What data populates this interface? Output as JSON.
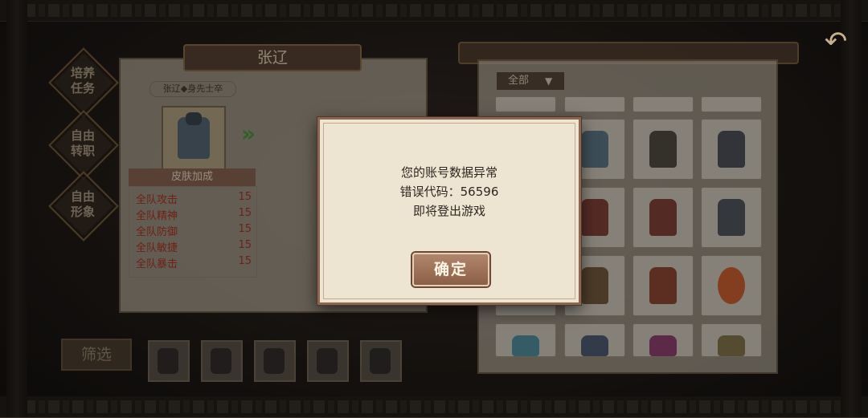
{
  "hero": {
    "name": "张辽",
    "subtitle": "张辽◆身先士卒",
    "bonus_title": "皮肤加成",
    "bonuses": [
      {
        "label": "全队攻击",
        "value": "15"
      },
      {
        "label": "全队精神",
        "value": "15"
      },
      {
        "label": "全队防御",
        "value": "15"
      },
      {
        "label": "全队敏捷",
        "value": "15"
      },
      {
        "label": "全队暴击",
        "value": "15"
      }
    ]
  },
  "nav": {
    "items": [
      "培养\n任务",
      "自由\n转职",
      "自由\n形象"
    ]
  },
  "filter": {
    "button": "筛选",
    "dropdown": "全部"
  },
  "dialog": {
    "line1": "您的账号数据异常",
    "line2": "错误代码：56596",
    "line3": "即将登出游戏",
    "confirm": "确定"
  },
  "colors": {
    "stat_red": "#b23626",
    "dialog_bg": "#eee4d2",
    "button": "#9a6e56"
  }
}
